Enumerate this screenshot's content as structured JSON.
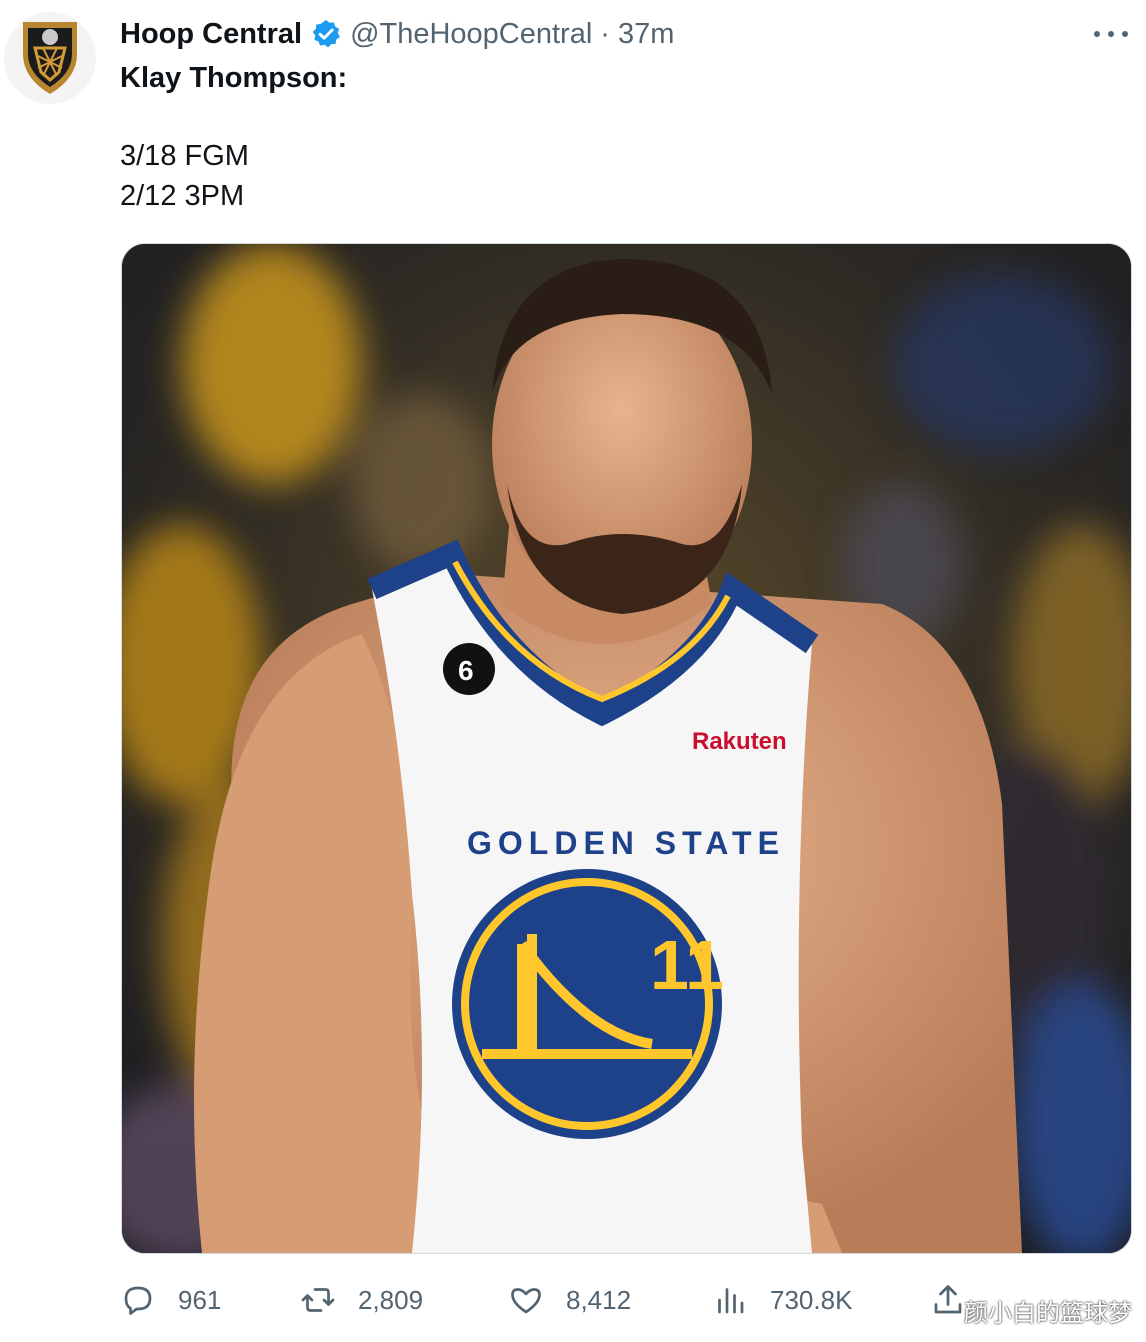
{
  "account": {
    "name": "Hoop Central",
    "handle": "@TheHoopCentral",
    "separator": "·",
    "time": "37m"
  },
  "tweet": {
    "headline": "Klay Thompson:",
    "lines": [
      "3/18 FGM",
      "2/12 3PM"
    ]
  },
  "media": {
    "jersey_sponsor": "Rakuten",
    "jersey_number": "11",
    "jersey_patch": "6",
    "jersey_text": "GOLDEN STATE"
  },
  "actions": {
    "replies": "961",
    "retweets": "2,809",
    "likes": "8,412",
    "views": "730.8K"
  },
  "watermark": "颜小白的篮球梦",
  "colors": {
    "verified": "#1d9bf0",
    "text_secondary": "#536471",
    "warriors_blue": "#1d428a",
    "warriors_gold": "#ffc72c"
  },
  "icons": [
    "hoop-central-logo-icon",
    "verified-badge-icon",
    "more-icon",
    "reply-icon",
    "retweet-icon",
    "like-icon",
    "views-icon",
    "share-icon"
  ]
}
